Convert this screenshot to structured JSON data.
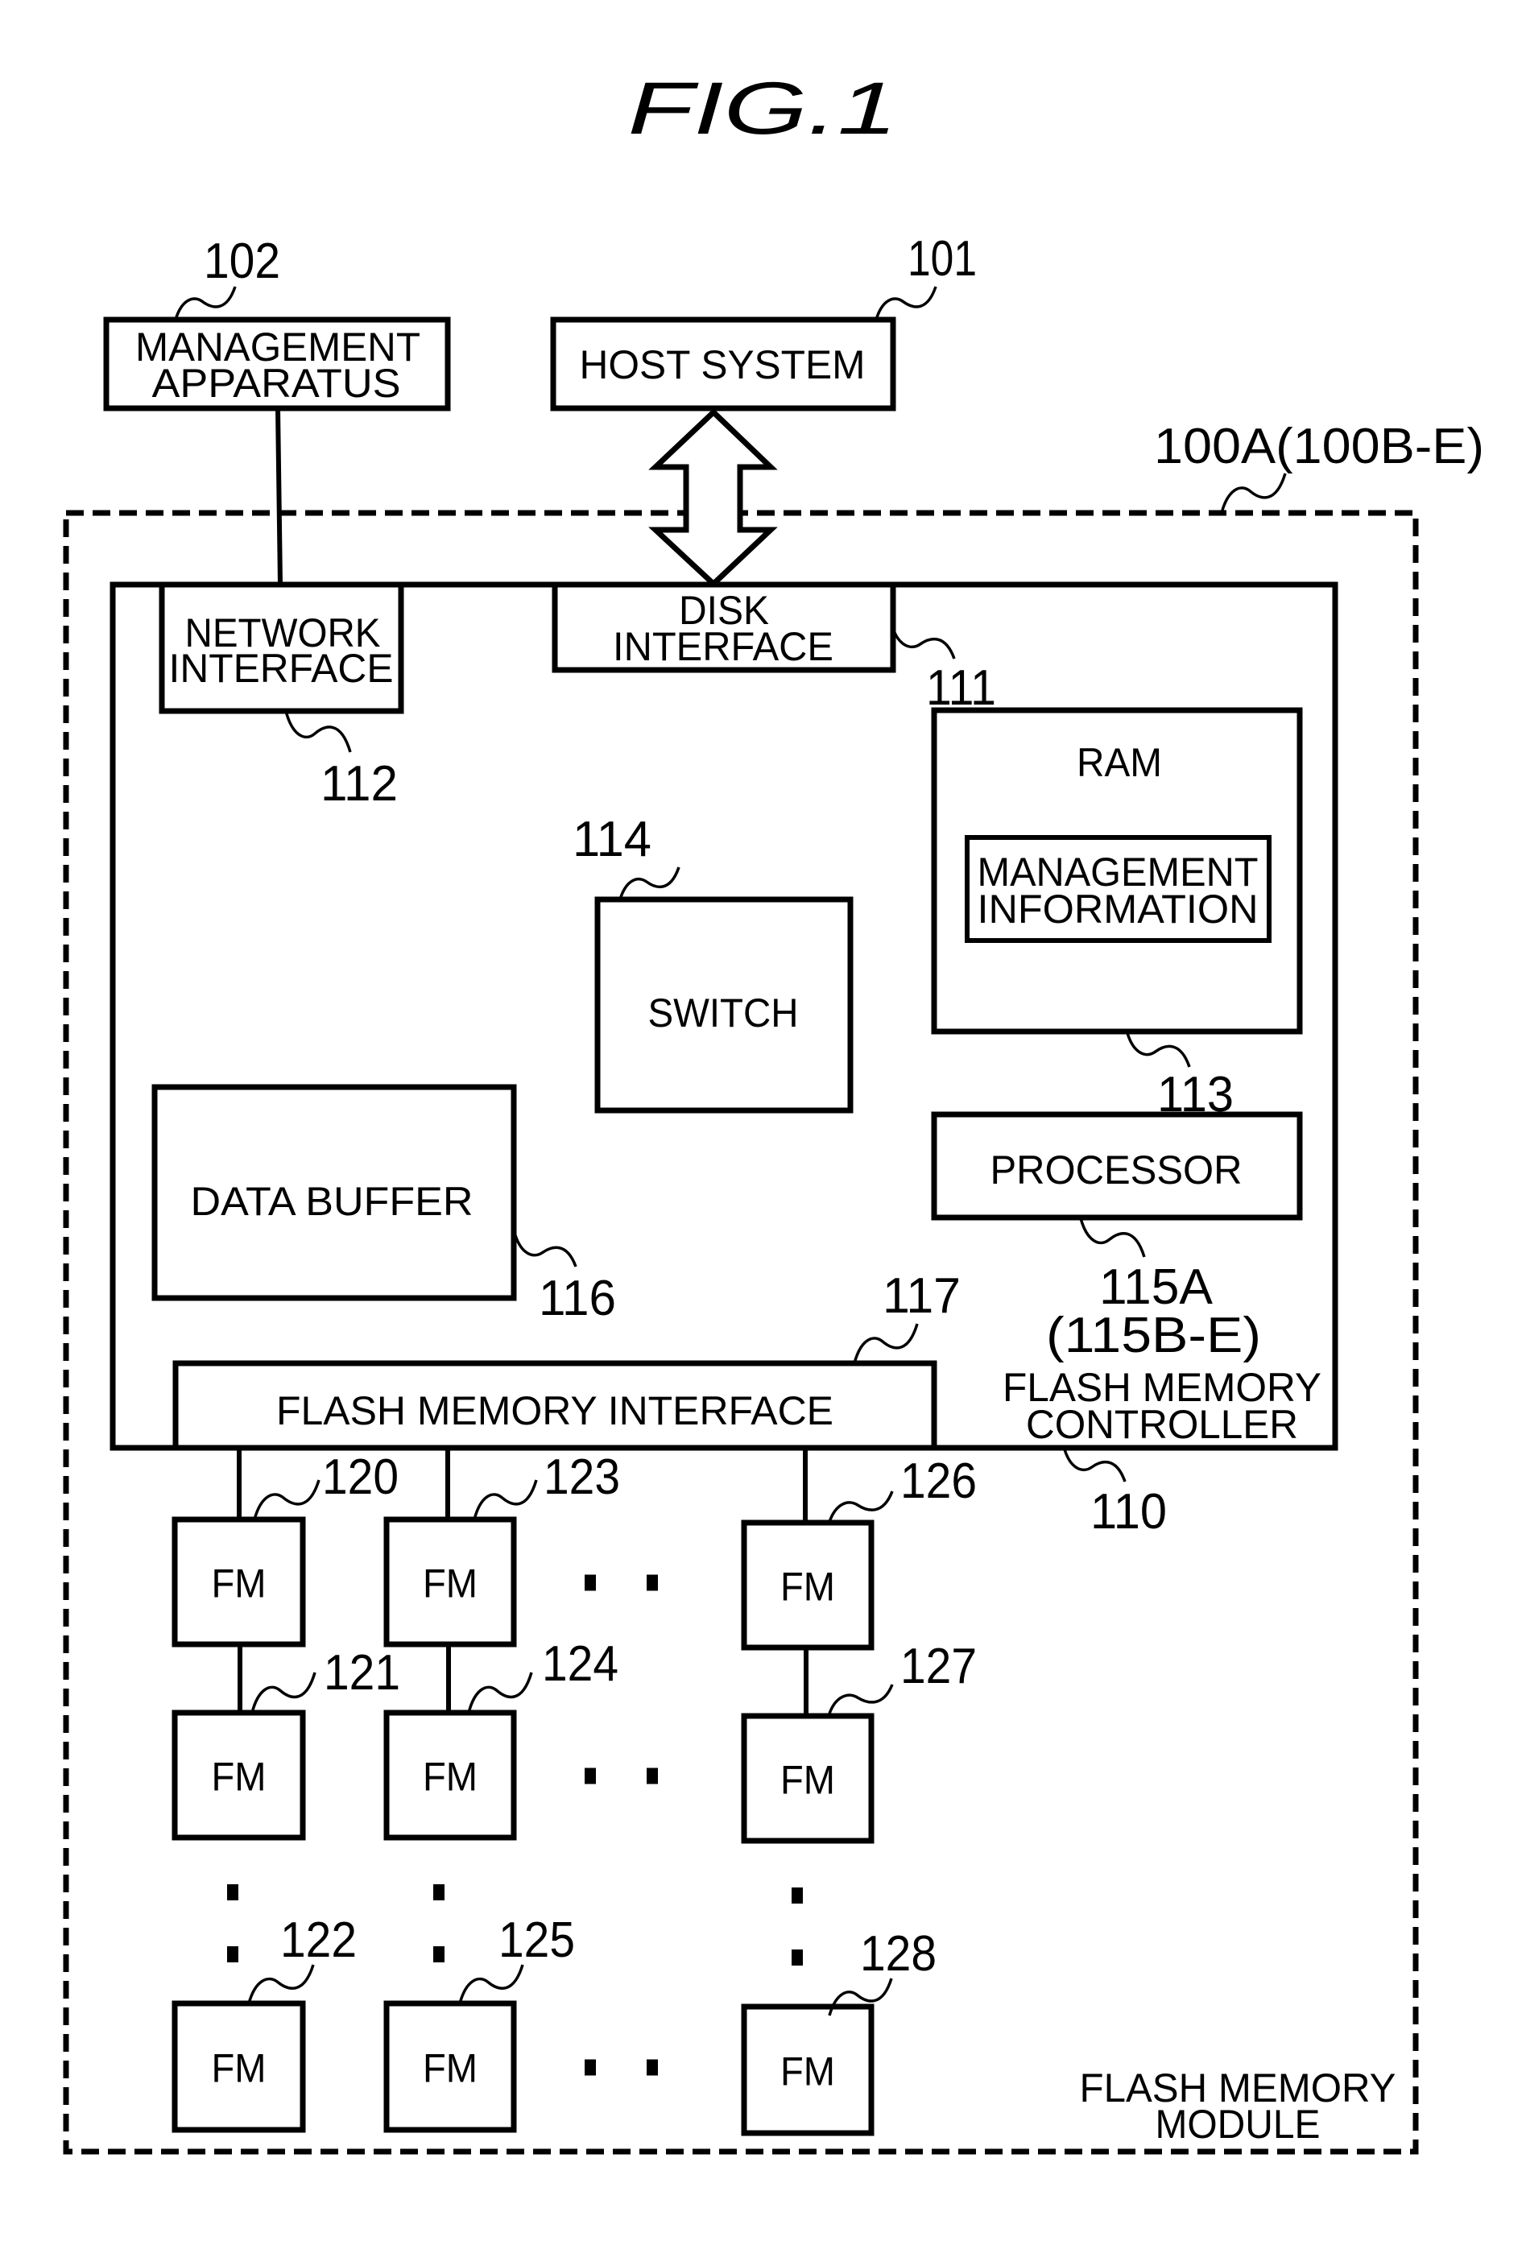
{
  "figure": {
    "title": "FIG.1",
    "colors": {
      "ink": "#000000",
      "background": "#ffffff"
    }
  },
  "external": {
    "management_apparatus": {
      "ref": "102",
      "lines": [
        "MANAGEMENT",
        "APPARATUS"
      ]
    },
    "host_system": {
      "ref": "101",
      "lines": [
        "HOST SYSTEM"
      ]
    }
  },
  "module": {
    "ref": "100A(100B-E)",
    "lines": [
      "FLASH MEMORY",
      "MODULE"
    ]
  },
  "controller": {
    "ref": "110",
    "lines": [
      "FLASH MEMORY",
      "CONTROLLER"
    ],
    "components": {
      "disk_interface": {
        "ref": "111",
        "lines": [
          "DISK",
          "INTERFACE"
        ]
      },
      "network_interface": {
        "ref": "112",
        "lines": [
          "NETWORK",
          "INTERFACE"
        ]
      },
      "ram": {
        "ref": "113",
        "lines": [
          "RAM"
        ]
      },
      "management_information": {
        "lines": [
          "MANAGEMENT",
          "INFORMATION"
        ]
      },
      "switch": {
        "ref": "114",
        "lines": [
          "SWITCH"
        ]
      },
      "processor": {
        "ref": "115A",
        "ref_alt": "(115B-E)",
        "lines": [
          "PROCESSOR"
        ]
      },
      "data_buffer": {
        "ref": "116",
        "lines": [
          "DATA BUFFER"
        ]
      },
      "flash_memory_interface": {
        "ref": "117",
        "lines": [
          "FLASH MEMORY INTERFACE"
        ]
      }
    }
  },
  "flash_memories": {
    "label": "FM",
    "ellipsis": "• •",
    "grid": [
      [
        {
          "ref": "120"
        },
        {
          "ref": "123"
        },
        {
          "ref": "126"
        }
      ],
      [
        {
          "ref": "121"
        },
        {
          "ref": "124"
        },
        {
          "ref": "127"
        }
      ],
      [
        {
          "ref": "122"
        },
        {
          "ref": "125"
        },
        {
          "ref": "128"
        }
      ]
    ]
  }
}
